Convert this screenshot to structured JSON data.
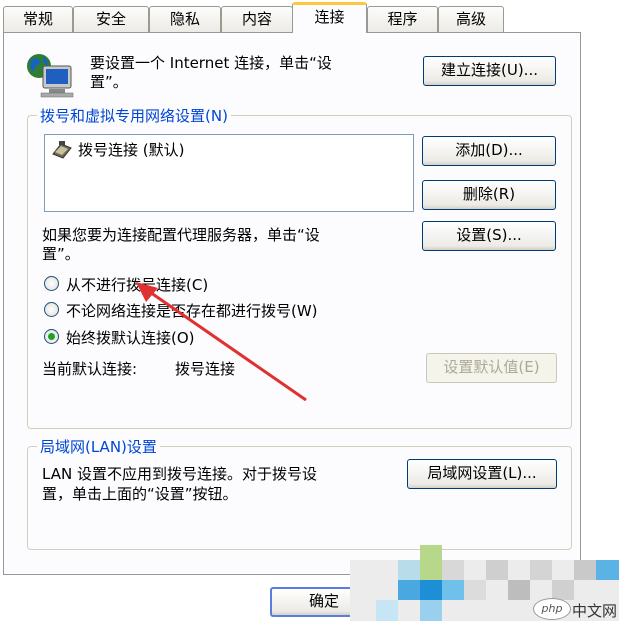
{
  "tabs": [
    {
      "label": "常规"
    },
    {
      "label": "安全"
    },
    {
      "label": "隐私"
    },
    {
      "label": "内容"
    },
    {
      "label": "连接"
    },
    {
      "label": "程序"
    },
    {
      "label": "高级"
    }
  ],
  "internet_setup": {
    "text_line1": "要设置一个 Internet 连接，单击“设",
    "text_line2": "置”。",
    "button": "建立连接(U)..."
  },
  "dialup_group": {
    "title": "拨号和虚拟专用网络设置(N)",
    "connections": [
      {
        "label": "拨号连接 (默认)"
      }
    ],
    "add_button": "添加(D)...",
    "remove_button": "删除(R)",
    "settings_button": "设置(S)...",
    "proxy_text_line1": "如果您要为连接配置代理服务器，单击“设",
    "proxy_text_line2": "置”。",
    "options": [
      {
        "label": "从不进行拨号连接(C)",
        "checked": false
      },
      {
        "label": "不论网络连接是否存在都进行拨号(W)",
        "checked": false
      },
      {
        "label": "始终拨默认连接(O)",
        "checked": true
      }
    ],
    "current_default_label": "当前默认连接:",
    "current_default_value": "拨号连接",
    "set_default_button": "设置默认值(E)"
  },
  "lan_group": {
    "title": "局域网(LAN)设置",
    "text_line1": "LAN 设置不应用到拨号连接。对于拨号设",
    "text_line2": "置，单击上面的“设置”按钮。",
    "button": "局域网设置(L)..."
  },
  "footer": {
    "ok_button": "确定"
  },
  "watermark": {
    "text": "中文网",
    "logo": "php"
  },
  "colors": {
    "group_title": "#0046d5",
    "arrow": "#e03030",
    "active_tab_highlight": "#ffc83c"
  }
}
